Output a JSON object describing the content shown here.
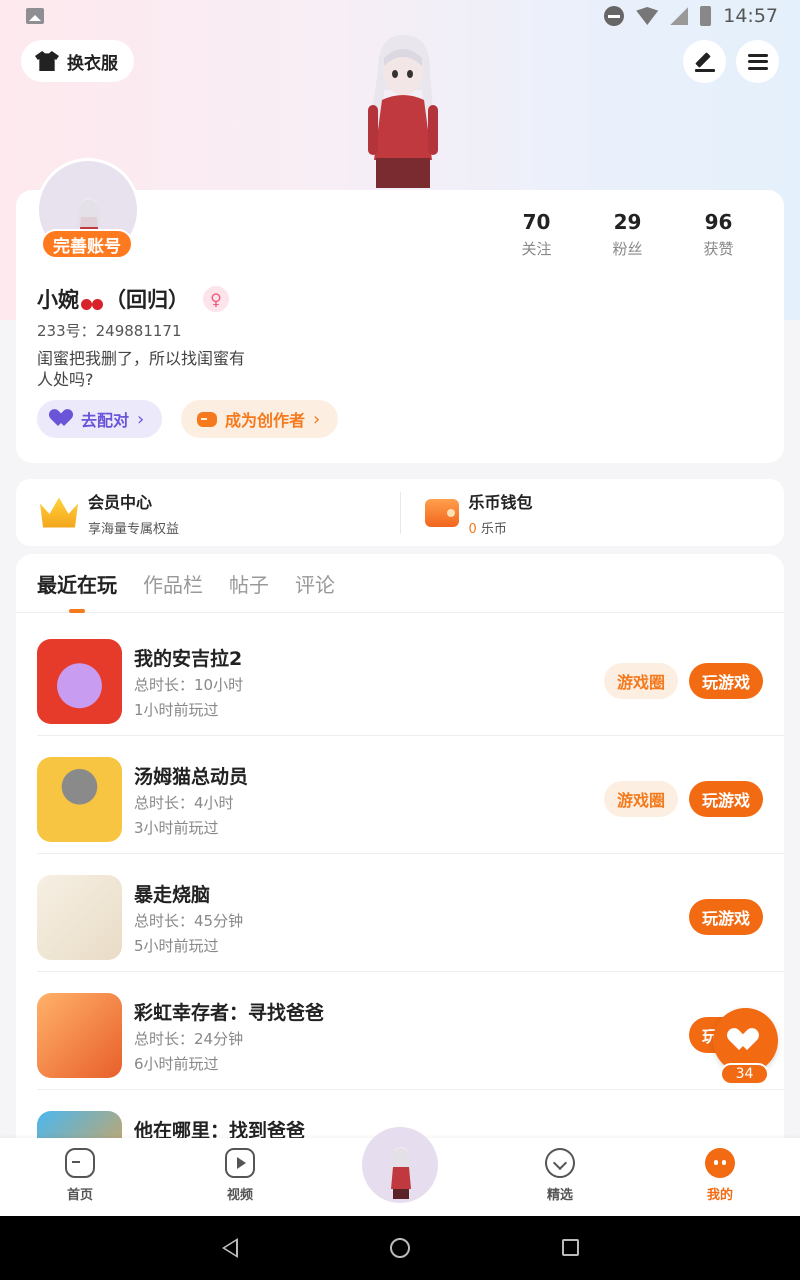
{
  "status_bar": {
    "time": "14:57"
  },
  "header": {
    "outfit_label": "换衣服"
  },
  "profile": {
    "badge": "完善账号",
    "nickname_a": "小婉",
    "nickname_b": "（回归）",
    "gender_symbol": "♀",
    "uid": "233号：249881171",
    "bio": "闺蜜把我删了，所以找闺蜜有人处吗?",
    "stats": [
      {
        "num": "70",
        "label": "关注"
      },
      {
        "num": "29",
        "label": "粉丝"
      },
      {
        "num": "96",
        "label": "获赞"
      }
    ],
    "match_label": "去配对",
    "creator_label": "成为创作者",
    "chevron": "›"
  },
  "member": {
    "vip_title": "会员中心",
    "vip_sub": "享海量专属权益",
    "wallet_title": "乐币钱包",
    "wallet_amount": "0",
    "wallet_unit": " 乐币"
  },
  "tabs": [
    "最近在玩",
    "作品栏",
    "帖子",
    "评论"
  ],
  "games": [
    {
      "name": "我的安吉拉2",
      "duration": "总时长：10小时",
      "last": "1小时前玩过",
      "circle": "游戏圈",
      "play": "玩游戏"
    },
    {
      "name": "汤姆猫总动员",
      "duration": "总时长：4小时",
      "last": "3小时前玩过",
      "circle": "游戏圈",
      "play": "玩游戏"
    },
    {
      "name": "暴走烧脑",
      "duration": "总时长：45分钟",
      "last": "5小时前玩过",
      "play": "玩游戏"
    },
    {
      "name": "彩虹幸存者：寻找爸爸",
      "duration": "总时长：24分钟",
      "last": "6小时前玩过",
      "play": "玩游戏"
    },
    {
      "name": "他在哪里：找到爸爸"
    }
  ],
  "float_like": {
    "count": "34"
  },
  "bottom_nav": [
    {
      "label": "首页"
    },
    {
      "label": "视频"
    },
    {
      "label": "精选"
    },
    {
      "label": "我的"
    }
  ]
}
